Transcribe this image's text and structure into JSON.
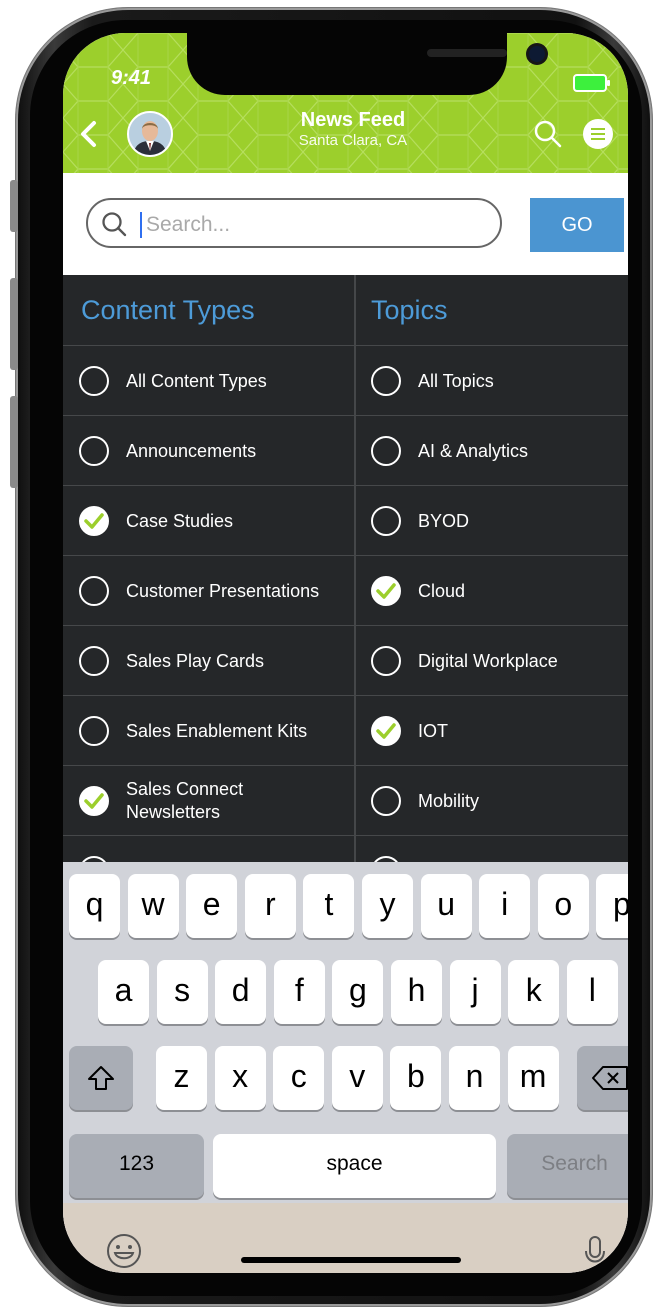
{
  "status_bar": {
    "time": "9:41"
  },
  "header": {
    "title": "News Feed",
    "subtitle": "Santa Clara, CA",
    "brand_color": "#9ccf2c"
  },
  "search": {
    "placeholder": "Search...",
    "go_label": "GO"
  },
  "filters": {
    "content_types_heading": "Content Types",
    "topics_heading": "Topics",
    "content_types": [
      {
        "label": "All Content Types",
        "checked": false
      },
      {
        "label": "Announcements",
        "checked": false
      },
      {
        "label": "Case Studies",
        "checked": true
      },
      {
        "label": "Customer Presentations",
        "checked": false
      },
      {
        "label": "Sales Play Cards",
        "checked": false
      },
      {
        "label": "Sales Enablement Kits",
        "checked": false
      },
      {
        "label": "Sales Connect Newsletters",
        "checked": true
      }
    ],
    "topics": [
      {
        "label": "All Topics",
        "checked": false
      },
      {
        "label": "AI & Analytics",
        "checked": false
      },
      {
        "label": "BYOD",
        "checked": false
      },
      {
        "label": "Cloud",
        "checked": true
      },
      {
        "label": "Digital Workplace",
        "checked": false
      },
      {
        "label": "IOT",
        "checked": true
      },
      {
        "label": "Mobility",
        "checked": false
      }
    ]
  },
  "keyboard": {
    "row1": [
      "q",
      "w",
      "e",
      "r",
      "t",
      "y",
      "u",
      "i",
      "o",
      "p"
    ],
    "row2": [
      "a",
      "s",
      "d",
      "f",
      "g",
      "h",
      "j",
      "k",
      "l"
    ],
    "row3": [
      "z",
      "x",
      "c",
      "v",
      "b",
      "n",
      "m"
    ],
    "numbers_label": "123",
    "space_label": "space",
    "search_label": "Search"
  },
  "icons": {
    "back": "chevron-left-icon",
    "search": "search-icon",
    "menu": "menu-icon",
    "shift": "shift-icon",
    "delete": "backspace-icon",
    "emoji": "emoji-icon",
    "mic": "microphone-icon"
  }
}
